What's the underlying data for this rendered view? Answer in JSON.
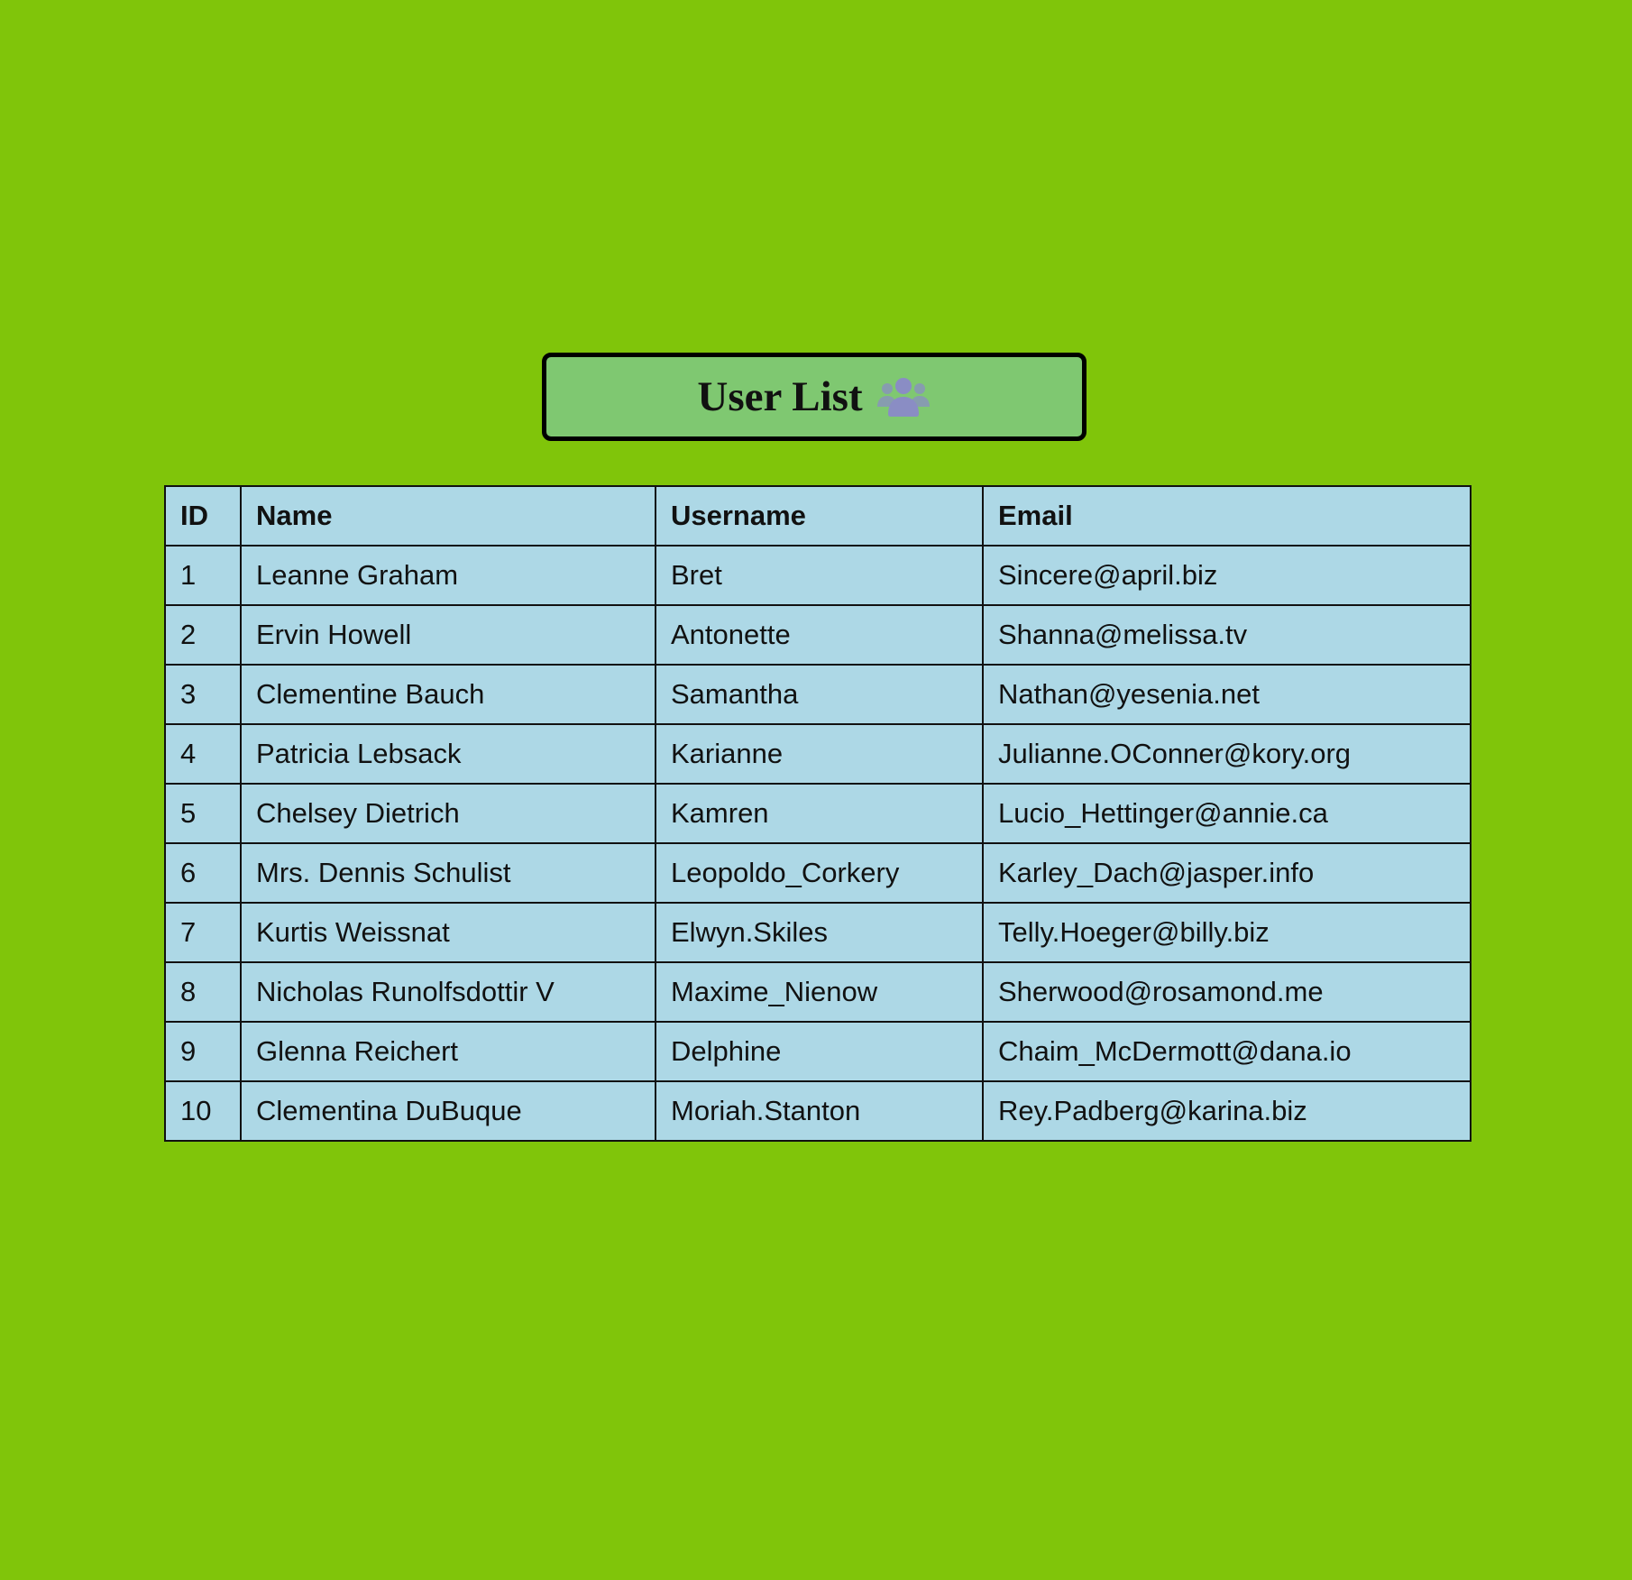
{
  "header": {
    "title": "User List",
    "icon": "users-icon",
    "icon_color": "#8a8dc4"
  },
  "colors": {
    "background": "#80c50a",
    "title_box": "#7fc871",
    "table_background": "#add8e6",
    "border": "#111111"
  },
  "table": {
    "columns": [
      "ID",
      "Name",
      "Username",
      "Email"
    ],
    "rows": [
      {
        "id": "1",
        "name": "Leanne Graham",
        "username": "Bret",
        "email": "Sincere@april.biz"
      },
      {
        "id": "2",
        "name": "Ervin Howell",
        "username": "Antonette",
        "email": "Shanna@melissa.tv"
      },
      {
        "id": "3",
        "name": "Clementine Bauch",
        "username": "Samantha",
        "email": "Nathan@yesenia.net"
      },
      {
        "id": "4",
        "name": "Patricia Lebsack",
        "username": "Karianne",
        "email": "Julianne.OConner@kory.org"
      },
      {
        "id": "5",
        "name": "Chelsey Dietrich",
        "username": "Kamren",
        "email": "Lucio_Hettinger@annie.ca"
      },
      {
        "id": "6",
        "name": "Mrs. Dennis Schulist",
        "username": "Leopoldo_Corkery",
        "email": "Karley_Dach@jasper.info"
      },
      {
        "id": "7",
        "name": "Kurtis Weissnat",
        "username": "Elwyn.Skiles",
        "email": "Telly.Hoeger@billy.biz"
      },
      {
        "id": "8",
        "name": "Nicholas Runolfsdottir V",
        "username": "Maxime_Nienow",
        "email": "Sherwood@rosamond.me"
      },
      {
        "id": "9",
        "name": "Glenna Reichert",
        "username": "Delphine",
        "email": "Chaim_McDermott@dana.io"
      },
      {
        "id": "10",
        "name": "Clementina DuBuque",
        "username": "Moriah.Stanton",
        "email": "Rey.Padberg@karina.biz"
      }
    ]
  }
}
